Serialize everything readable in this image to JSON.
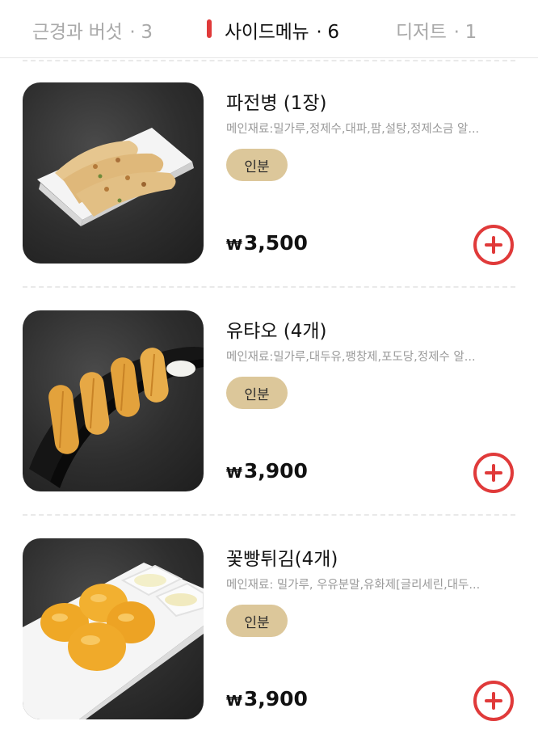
{
  "colors": {
    "accent": "#e03a3a",
    "badge_bg": "#dcc79a",
    "tab_inactive": "#a9a9a9",
    "tab_active": "#111111"
  },
  "tabs": [
    {
      "label": "근경과 버섯",
      "count": "· 3",
      "active": false
    },
    {
      "label": "사이드메뉴",
      "count": "· 6",
      "active": true
    },
    {
      "label": "디저트",
      "count": "· 1",
      "active": false
    },
    {
      "label": "",
      "count": "",
      "active": false
    }
  ],
  "items": [
    {
      "name": "파전병 (1장)",
      "description": "메인재료:밀가루,정제수,대파,팜,설탕,정제소금 알...",
      "badge": "인분",
      "currency": "₩",
      "price": "3,500",
      "image_icon": "green-onion-pancake-icon"
    },
    {
      "name": "유탸오 (4개)",
      "description": "메인재료:밀가루,대두유,팽창제,포도당,정제수 알...",
      "badge": "인분",
      "currency": "₩",
      "price": "3,900",
      "image_icon": "fried-dough-stick-icon"
    },
    {
      "name": "꽃빵튀김(4개)",
      "description": "메인재료: 밀가루, 우유분말,유화제[글리세린,대두...",
      "badge": "인분",
      "currency": "₩",
      "price": "3,900",
      "image_icon": "fried-flower-bun-icon"
    }
  ]
}
